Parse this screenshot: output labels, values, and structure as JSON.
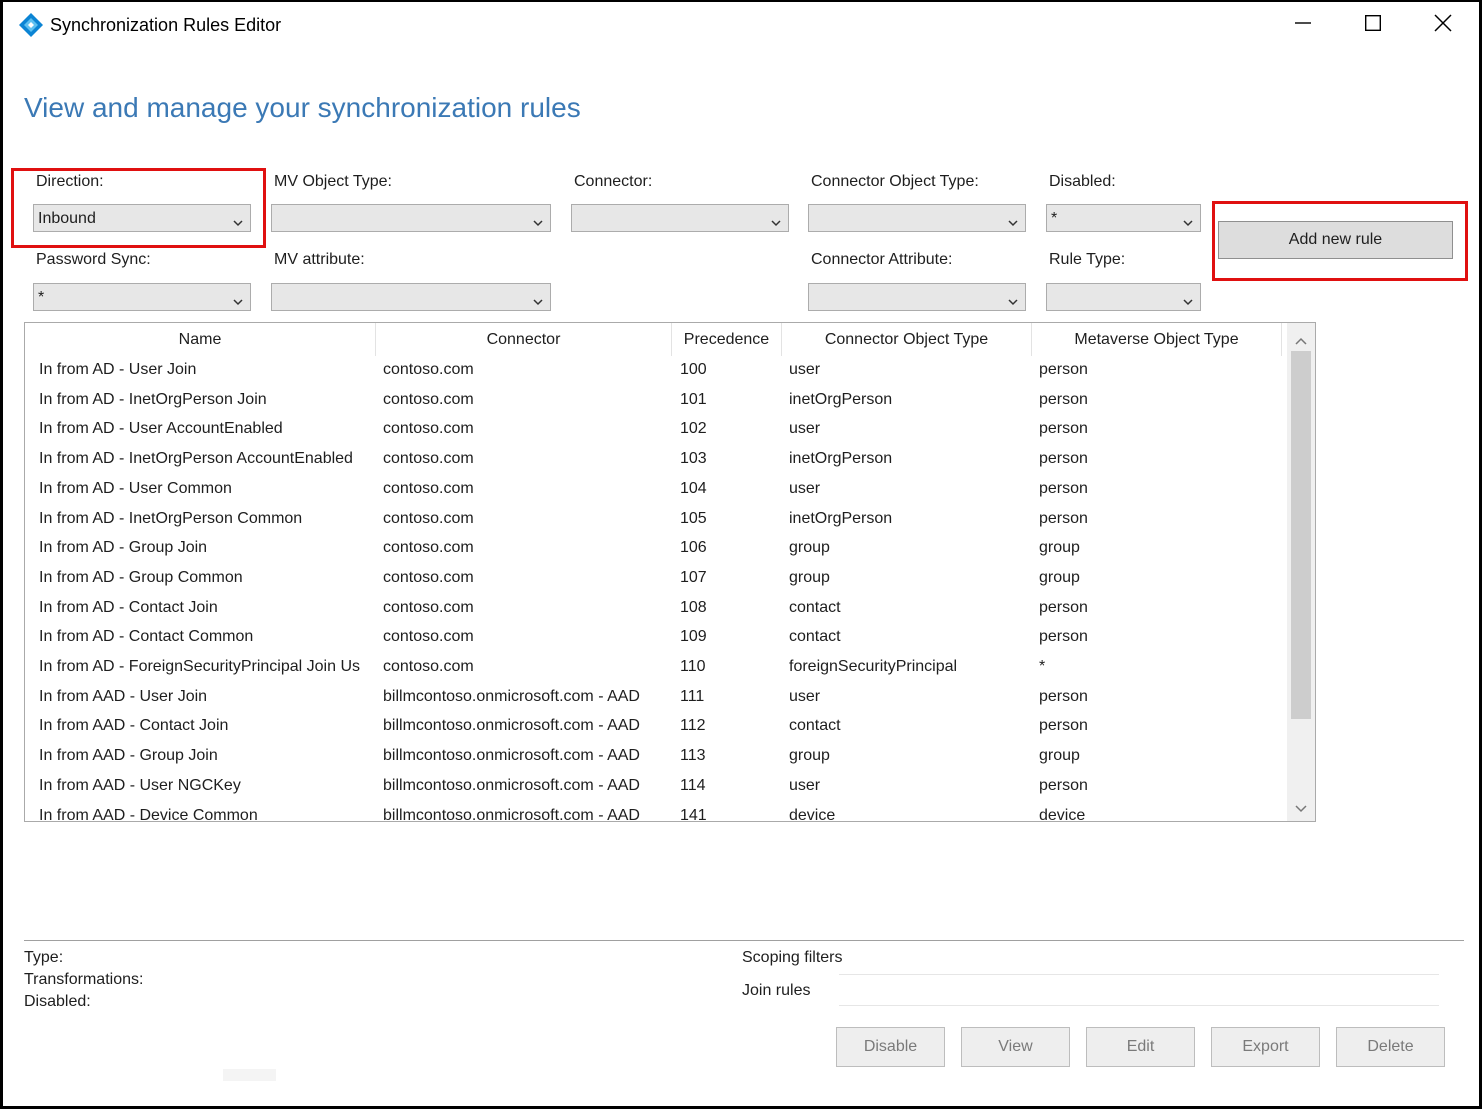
{
  "window": {
    "title": "Synchronization Rules Editor",
    "controls": {
      "minimize": "minimize-icon",
      "maximize": "maximize-icon",
      "close": "close-icon"
    }
  },
  "heading": "View and manage your synchronization rules",
  "filters": {
    "direction": {
      "label": "Direction:",
      "value": "Inbound"
    },
    "mv_object_type": {
      "label": "MV Object Type:",
      "value": ""
    },
    "connector": {
      "label": "Connector:",
      "value": ""
    },
    "connector_object_type": {
      "label": "Connector Object Type:",
      "value": ""
    },
    "disabled": {
      "label": "Disabled:",
      "value": "*"
    },
    "password_sync": {
      "label": "Password Sync:",
      "value": "*"
    },
    "mv_attribute": {
      "label": "MV attribute:",
      "value": ""
    },
    "connector_attribute": {
      "label": "Connector Attribute:",
      "value": ""
    },
    "rule_type": {
      "label": "Rule Type:",
      "value": ""
    }
  },
  "add_button": "Add new rule",
  "grid": {
    "columns": [
      "Name",
      "Connector",
      "Precedence",
      "Connector Object Type",
      "Metaverse Object Type"
    ],
    "rows": [
      [
        "In from AD - User Join",
        "contoso.com",
        "100",
        "user",
        "person"
      ],
      [
        "In from AD - InetOrgPerson Join",
        "contoso.com",
        "101",
        "inetOrgPerson",
        "person"
      ],
      [
        "In from AD - User AccountEnabled",
        "contoso.com",
        "102",
        "user",
        "person"
      ],
      [
        "In from AD - InetOrgPerson AccountEnabled",
        "contoso.com",
        "103",
        "inetOrgPerson",
        "person"
      ],
      [
        "In from AD - User Common",
        "contoso.com",
        "104",
        "user",
        "person"
      ],
      [
        "In from AD - InetOrgPerson Common",
        "contoso.com",
        "105",
        "inetOrgPerson",
        "person"
      ],
      [
        "In from AD - Group Join",
        "contoso.com",
        "106",
        "group",
        "group"
      ],
      [
        "In from AD - Group Common",
        "contoso.com",
        "107",
        "group",
        "group"
      ],
      [
        "In from AD - Contact Join",
        "contoso.com",
        "108",
        "contact",
        "person"
      ],
      [
        "In from AD - Contact Common",
        "contoso.com",
        "109",
        "contact",
        "person"
      ],
      [
        "In from AD - ForeignSecurityPrincipal Join Us",
        "contoso.com",
        "110",
        "foreignSecurityPrincipal",
        "*"
      ],
      [
        "In from AAD - User Join",
        "billmcontoso.onmicrosoft.com - AAD",
        "111",
        "user",
        "person"
      ],
      [
        "In from AAD - Contact Join",
        "billmcontoso.onmicrosoft.com - AAD",
        "112",
        "contact",
        "person"
      ],
      [
        "In from AAD - Group Join",
        "billmcontoso.onmicrosoft.com - AAD",
        "113",
        "group",
        "group"
      ],
      [
        "In from AAD - User NGCKey",
        "billmcontoso.onmicrosoft.com - AAD",
        "114",
        "user",
        "person"
      ],
      [
        "In from AAD - Device Common",
        "billmcontoso.onmicrosoft.com - AAD",
        "141",
        "device",
        "device"
      ]
    ]
  },
  "details": {
    "type_label": "Type:",
    "transformations_label": "Transformations:",
    "disabled_label": "Disabled:",
    "scoping_filters_label": "Scoping filters",
    "join_rules_label": "Join rules"
  },
  "actions": [
    "Disable",
    "View",
    "Edit",
    "Export",
    "Delete"
  ],
  "colors": {
    "accent": "#3b79b5",
    "highlight": "#e01010",
    "text": "#1e1e1e",
    "disabled_text": "#7a7a7a"
  }
}
